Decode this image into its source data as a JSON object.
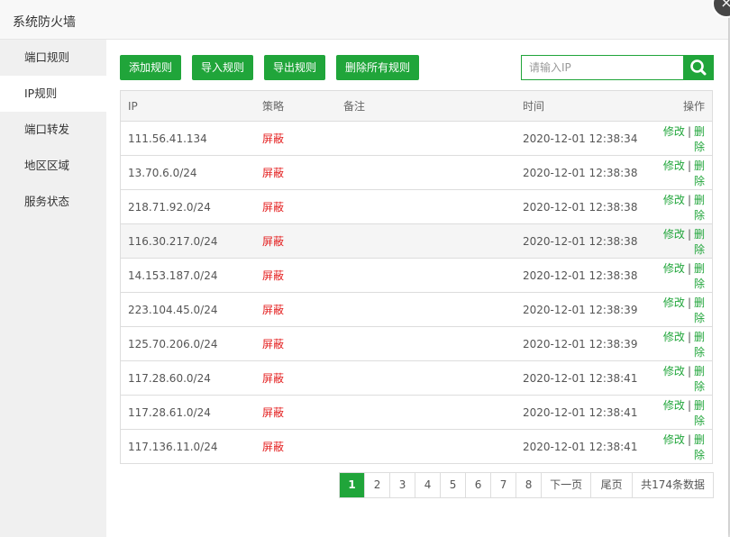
{
  "dialog": {
    "title": "系统防火墙",
    "close_glyph": "×"
  },
  "sidebar": {
    "items": [
      {
        "label": "端口规则",
        "active": false
      },
      {
        "label": "IP规则",
        "active": true
      },
      {
        "label": "端口转发",
        "active": false
      },
      {
        "label": "地区区域",
        "active": false
      },
      {
        "label": "服务状态",
        "active": false
      }
    ]
  },
  "toolbar": {
    "add_label": "添加规则",
    "import_label": "导入规则",
    "export_label": "导出规则",
    "delete_all_label": "删除所有规则"
  },
  "search": {
    "placeholder": "请输入IP",
    "value": "",
    "icon": "search-icon"
  },
  "table": {
    "headers": {
      "ip": "IP",
      "policy": "策略",
      "note": "备注",
      "time": "时间",
      "op": "操作"
    },
    "rows": [
      {
        "ip": "111.56.41.134",
        "policy": "屏蔽",
        "note": "",
        "time": "2020-12-01 12:38:34"
      },
      {
        "ip": "13.70.6.0/24",
        "policy": "屏蔽",
        "note": "",
        "time": "2020-12-01 12:38:38"
      },
      {
        "ip": "218.71.92.0/24",
        "policy": "屏蔽",
        "note": "",
        "time": "2020-12-01 12:38:38"
      },
      {
        "ip": "116.30.217.0/24",
        "policy": "屏蔽",
        "note": "",
        "time": "2020-12-01 12:38:38"
      },
      {
        "ip": "14.153.187.0/24",
        "policy": "屏蔽",
        "note": "",
        "time": "2020-12-01 12:38:38"
      },
      {
        "ip": "223.104.45.0/24",
        "policy": "屏蔽",
        "note": "",
        "time": "2020-12-01 12:38:39"
      },
      {
        "ip": "125.70.206.0/24",
        "policy": "屏蔽",
        "note": "",
        "time": "2020-12-01 12:38:39"
      },
      {
        "ip": "117.28.60.0/24",
        "policy": "屏蔽",
        "note": "",
        "time": "2020-12-01 12:38:41"
      },
      {
        "ip": "117.28.61.0/24",
        "policy": "屏蔽",
        "note": "",
        "time": "2020-12-01 12:38:41"
      },
      {
        "ip": "117.136.11.0/24",
        "policy": "屏蔽",
        "note": "",
        "time": "2020-12-01 12:38:41"
      }
    ],
    "edit_label": "修改",
    "separator": "|",
    "delete_label": "删除"
  },
  "pagination": {
    "pages": [
      "1",
      "2",
      "3",
      "4",
      "5",
      "6",
      "7",
      "8"
    ],
    "current": "1",
    "next_label": "下一页",
    "last_label": "尾页",
    "total_label": "共174条数据"
  },
  "colors": {
    "accent": "#20a53a",
    "danger": "#e41f1f"
  }
}
